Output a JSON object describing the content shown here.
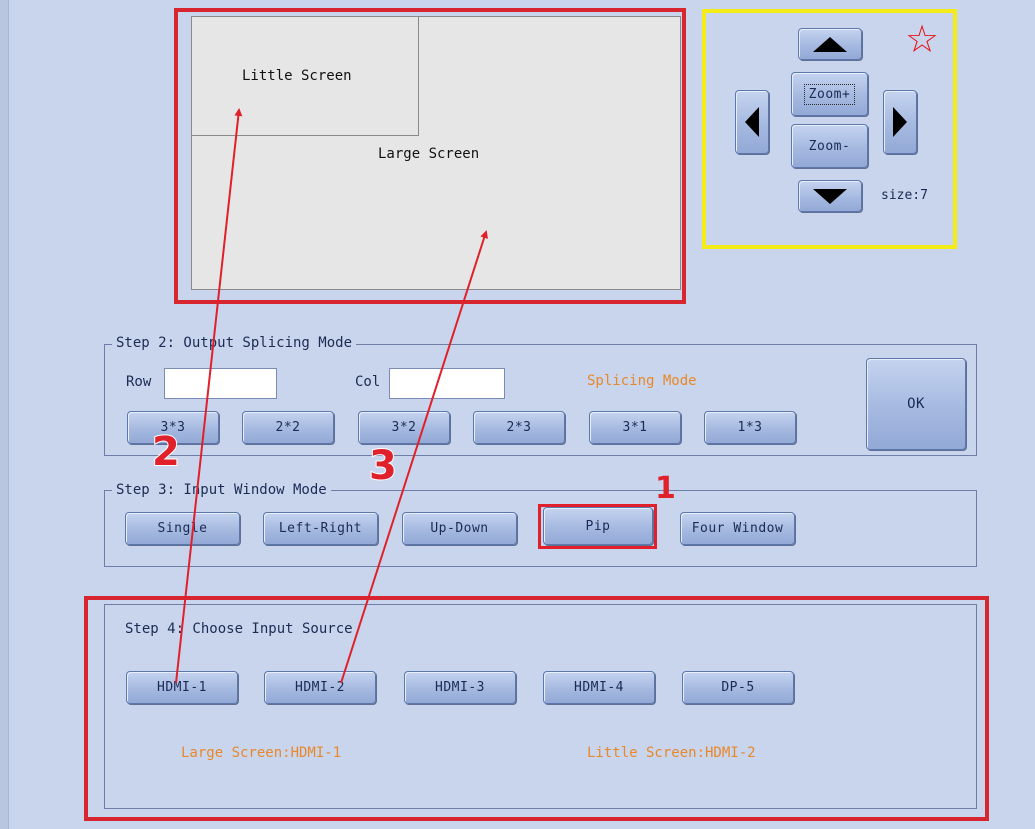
{
  "preview": {
    "little_label": "Little Screen",
    "large_label": "Large Screen"
  },
  "pad": {
    "zoom_in": "Zoom+",
    "zoom_out": "Zoom-",
    "size_label": "size:7",
    "star": "☆",
    "icons": [
      "up-arrow-icon",
      "down-arrow-icon",
      "left-arrow-icon",
      "right-arrow-icon",
      "star-icon"
    ]
  },
  "step2": {
    "title": "Step 2: Output Splicing Mode",
    "row_label": "Row",
    "col_label": "Col",
    "row_value": "",
    "col_value": "",
    "splicing_mode_label": "Splicing Mode",
    "ok_label": "OK",
    "presets": [
      "3*3",
      "2*2",
      "3*2",
      "2*3",
      "3*1",
      "1*3"
    ]
  },
  "step3": {
    "title": "Step 3: Input Window Mode",
    "modes": [
      "Single",
      "Left-Right",
      "Up-Down",
      "Pip",
      "Four Window"
    ]
  },
  "step4": {
    "title": "Step 4: Choose  Input Source",
    "sources": [
      "HDMI-1",
      "HDMI-2",
      "HDMI-3",
      "HDMI-4",
      "DP-5"
    ],
    "large_screen_status": "Large Screen:HDMI-1",
    "little_screen_status": "Little Screen:HDMI-2"
  },
  "annotations": {
    "n1": "1",
    "n2": "2",
    "n3": "3"
  },
  "colors": {
    "background": "#c9d5ec",
    "highlight_red": "#d7262f",
    "highlight_yellow": "#f4ec18",
    "orange_text": "#e8882a"
  }
}
